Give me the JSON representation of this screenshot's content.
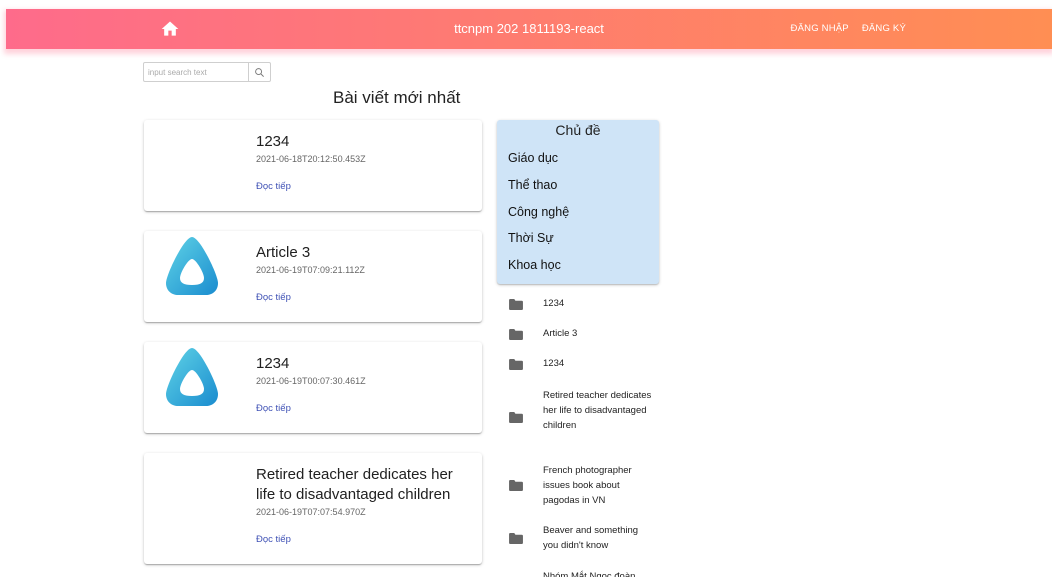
{
  "header": {
    "title": "ttcnpm 202 1811193-react",
    "login_label": "ĐĂNG NHẬP",
    "signup_label": "ĐĂNG KÝ",
    "gradient_from": "#fe6b8b",
    "gradient_to": "#ff8e53"
  },
  "search": {
    "placeholder": "input search text",
    "value": ""
  },
  "main": {
    "section_title": "Bài viết mới nhất",
    "read_more_label": "Đọc tiếp",
    "articles": [
      {
        "title": "1234",
        "date": "2021-06-18T20:12:50.453Z",
        "has_image": false
      },
      {
        "title": "Article 3",
        "date": "2021-06-19T07:09:21.112Z",
        "has_image": true
      },
      {
        "title": "1234",
        "date": "2021-06-19T00:07:30.461Z",
        "has_image": true
      },
      {
        "title": "Retired teacher dedicates her life to disadvantaged children",
        "date": "2021-06-19T07:07:54.970Z",
        "has_image": false
      }
    ]
  },
  "topics": {
    "heading": "Chủ đề",
    "items": [
      "Giáo dục",
      "Thể thao",
      "Công nghệ",
      "Thời Sự",
      "Khoa học"
    ],
    "background": "#cfe4f7"
  },
  "article_list": {
    "icon": "folder-icon",
    "items": [
      "1234",
      "Article 3",
      "1234",
      "Retired teacher dedicates her life to disadvantaged children",
      "French photographer issues book about pagodas in VN",
      "Beaver and something you didn't know",
      "Nhóm Mắt Ngọc đoàn"
    ]
  }
}
